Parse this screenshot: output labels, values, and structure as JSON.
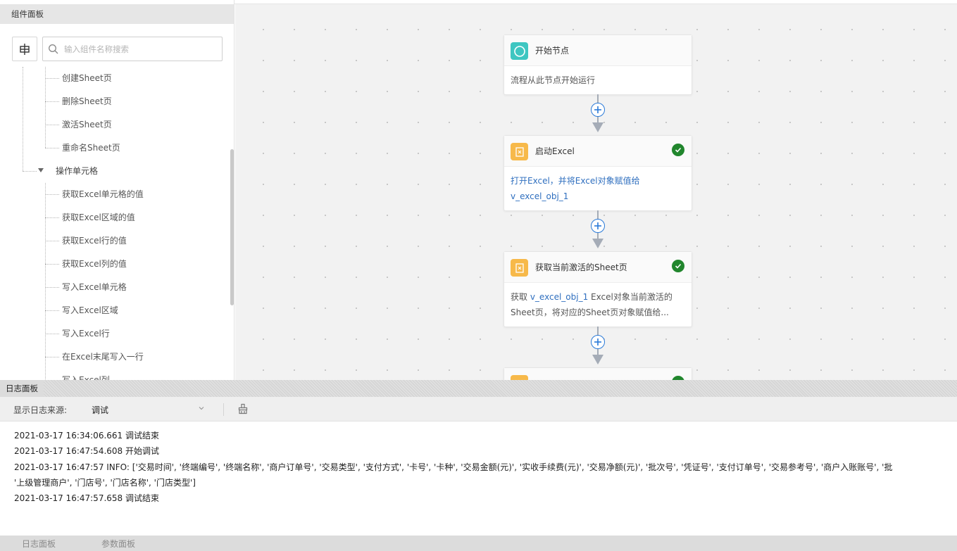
{
  "component_panel": {
    "title": "组件面板",
    "search_placeholder": "输入组件名称搜索",
    "tree_items": [
      {
        "label": "创建Sheet页",
        "kind": "child"
      },
      {
        "label": "删除Sheet页",
        "kind": "child"
      },
      {
        "label": "激活Sheet页",
        "kind": "child"
      },
      {
        "label": "重命名Sheet页",
        "kind": "child"
      },
      {
        "label": "操作单元格",
        "kind": "group"
      },
      {
        "label": "获取Excel单元格的值",
        "kind": "child"
      },
      {
        "label": "获取Excel区域的值",
        "kind": "child"
      },
      {
        "label": "获取Excel行的值",
        "kind": "child"
      },
      {
        "label": "获取Excel列的值",
        "kind": "child"
      },
      {
        "label": "写入Excel单元格",
        "kind": "child"
      },
      {
        "label": "写入Excel区域",
        "kind": "child"
      },
      {
        "label": "写入Excel行",
        "kind": "child"
      },
      {
        "label": "在Excel末尾写入一行",
        "kind": "child"
      },
      {
        "label": "写入Excel列",
        "kind": "child"
      }
    ]
  },
  "flow": {
    "nodes": [
      {
        "title": "开始节点",
        "icon": "circle-start-icon",
        "icon_color": "#3ec6c1",
        "desc_plain": "流程从此节点开始运行",
        "status": "none"
      },
      {
        "title": "启动Excel",
        "icon": "excel-doc-icon",
        "icon_color": "#f7b94a",
        "desc_prefix": "打开Excel，并将Excel对象赋值给",
        "desc_var": "v_excel_obj_1",
        "status": "success"
      },
      {
        "title": "获取当前激活的Sheet页",
        "icon": "excel-doc-icon",
        "icon_color": "#f7b94a",
        "desc_prefix": "获取 ",
        "desc_var": "v_excel_obj_1",
        "desc_suffix": " Excel对象当前激活的",
        "desc_line2": "Sheet页，将对应的Sheet页对象赋值给...",
        "status": "success"
      },
      {
        "title": "",
        "icon": "excel-doc-icon",
        "icon_color": "#f7b94a",
        "status": "success"
      }
    ]
  },
  "log_panel": {
    "title": "日志面板",
    "source_label": "显示日志来源:",
    "source_value": "调试",
    "lines": [
      "2021-03-17 16:34:06.661 调试结束",
      "2021-03-17 16:47:54.608 开始调试",
      "2021-03-17 16:47:57 INFO: ['交易时间', '终端编号', '终端名称', '商户订单号', '交易类型', '支付方式', '卡号', '卡种', '交易金额(元)', '实收手续费(元)', '交易净额(元)', '批次号', '凭证号', '支付订单号', '交易参考号', '商户入账账号', '批",
      "'上级管理商户', '门店号', '门店名称', '门店类型']",
      "2021-03-17 16:47:57.658 调试结束"
    ]
  },
  "bottom_tabs": [
    "日志面板",
    "参数面板"
  ]
}
